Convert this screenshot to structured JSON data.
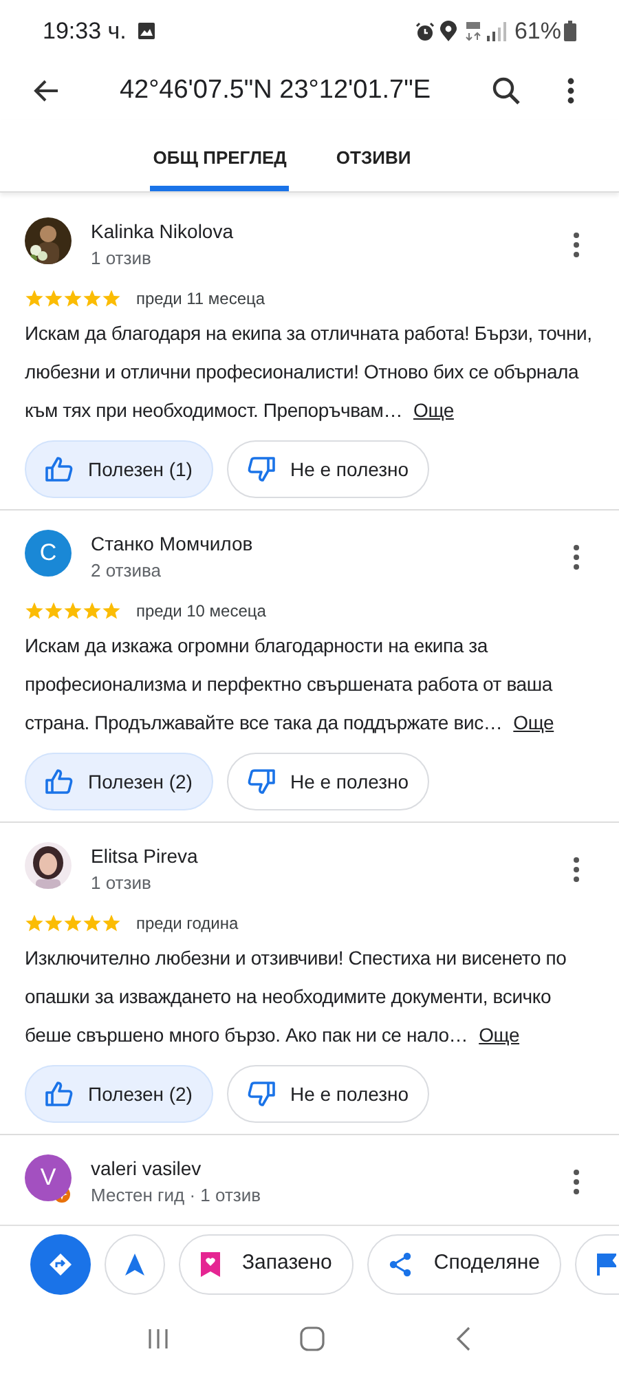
{
  "status_bar": {
    "time": "19:33 ч.",
    "battery": "61%"
  },
  "top_bar": {
    "title": "42°46'07.5\"N 23°12'01.7\"E"
  },
  "tabs": [
    {
      "label": "ОБЩ ПРЕГЛЕД",
      "selected": true
    },
    {
      "label": "ОТЗИВИ",
      "selected": false
    }
  ],
  "reviews": [
    {
      "name": "Kalinka Nikolova",
      "meta": "1 отзив",
      "stars": 5,
      "time": "преди 11 месеца",
      "text": "Искам да благодаря на екипа за отличната работа!  Бързи, точни, любезни и отлични професионалисти! Отново бих се обърнала към тях при необходимост. Препоръчвам…",
      "more": "Още",
      "helpful": {
        "label": "Полезен (1)"
      },
      "not_helpful": {
        "label": "Не е полезно"
      }
    },
    {
      "name": "Станко Момчилов",
      "avatar": {
        "kind": "letter",
        "letter": "C",
        "color": "#1a88d6"
      },
      "meta": "2 отзива",
      "stars": 5,
      "time": "преди 10 месеца",
      "text": "Искам да изкажа огромни благодарности на екипа за професионализма и перфектно свършената работа от ваша страна. Продължавайте все така да поддържате вис…",
      "more": "Още",
      "helpful": {
        "label": "Полезен (2)"
      },
      "not_helpful": {
        "label": "Не е полезно"
      }
    },
    {
      "name": "Elitsa Pireva",
      "meta": "1 отзив",
      "stars": 5,
      "time": "преди година",
      "text": "Изключително любезни и отзивчиви! Спестиха ни висенето по опашки за изваждането на необходимите документи, всичко беше свършено много бързо. Ако пак ни се нало…",
      "more": "Още",
      "helpful": {
        "label": "Полезен (2)"
      },
      "not_helpful": {
        "label": "Не е полезно"
      }
    },
    {
      "name": "valeri vasilev",
      "avatar": {
        "kind": "letter",
        "letter": "V",
        "color": "#a350c0"
      },
      "meta": "Местен гид · 1 отзив",
      "local_guide": true
    }
  ],
  "actions": [
    {
      "kind": "directions"
    },
    {
      "kind": "start"
    },
    {
      "kind": "save",
      "label": "Запазено"
    },
    {
      "kind": "share",
      "label": "Споделяне"
    },
    {
      "kind": "flag"
    }
  ]
}
